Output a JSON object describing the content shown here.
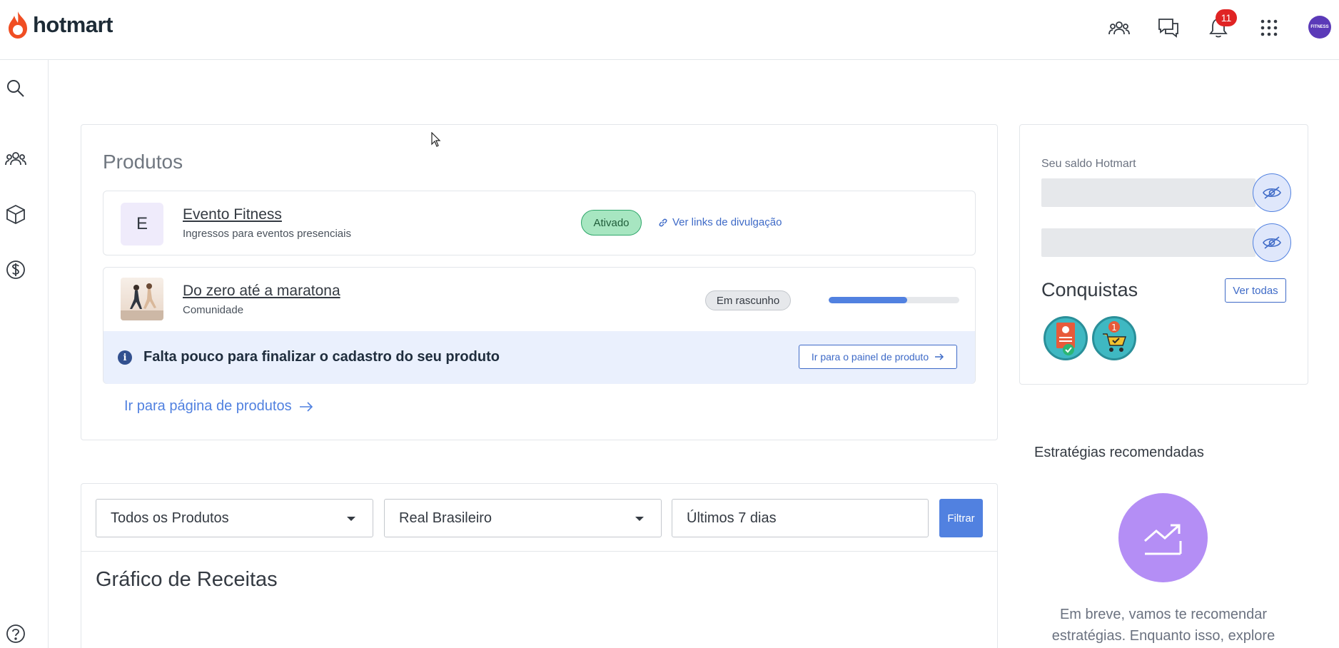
{
  "header": {
    "brand": "hotmart",
    "notifications_count": "11",
    "avatar_label": "FITNESS",
    "icons": [
      "users-icon",
      "chat-icon",
      "bell-icon",
      "apps-grid-icon"
    ]
  },
  "sidebar": {
    "items": [
      "search-icon",
      "users-icon",
      "box-icon",
      "dollar-icon",
      "help-icon"
    ]
  },
  "products": {
    "title": "Produtos",
    "items": [
      {
        "thumb_letter": "E",
        "name": "Evento Fitness",
        "subtitle": "Ingressos para eventos presenciais",
        "status": "Ativado",
        "link_label": "Ver links de divulgação"
      },
      {
        "name": "Do zero até a maratona",
        "subtitle": "Comunidade",
        "status": "Em rascunho",
        "progress": 0.6,
        "notice": "Falta pouco para finalizar o cadastro do seu produto",
        "notice_button": "Ir para o painel de produto"
      }
    ],
    "goto_label": "Ir para página de produtos"
  },
  "balance": {
    "label": "Seu saldo Hotmart",
    "achievements_title": "Conquistas",
    "see_all_label": "Ver todas"
  },
  "strategies": {
    "title": "Estratégias recomendadas",
    "text": "Em breve, vamos te recomendar estratégias. Enquanto isso, explore"
  },
  "filters": {
    "product_select": "Todos os Produtos",
    "currency_select": "Real Brasileiro",
    "period": "Últimos 7 dias",
    "filter_button": "Filtrar",
    "chart_title": "Gráfico de Receitas"
  },
  "colors": {
    "brand_orange": "#f04e23",
    "primary_blue": "#5181e0",
    "success_green": "#a7e6c1",
    "strategy_purple": "#b48ef5"
  }
}
